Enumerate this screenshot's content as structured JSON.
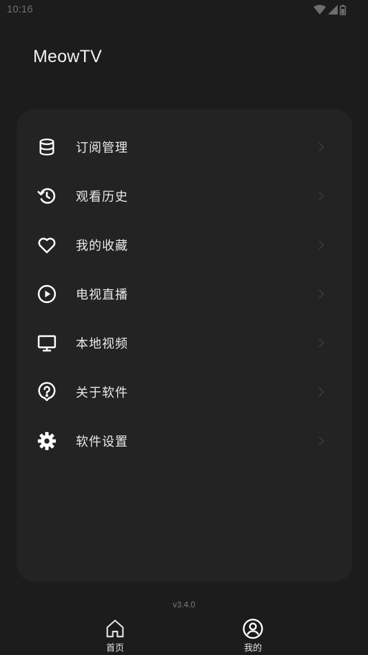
{
  "status_bar": {
    "time": "10:16",
    "icons": [
      "wifi-icon",
      "signal-icon",
      "battery-icon"
    ]
  },
  "app": {
    "title": "MeowTV"
  },
  "menu": {
    "items": [
      {
        "label": "订阅管理",
        "icon": "database-icon"
      },
      {
        "label": "观看历史",
        "icon": "history-icon"
      },
      {
        "label": "我的收藏",
        "icon": "heart-icon"
      },
      {
        "label": "电视直播",
        "icon": "play-circle-icon"
      },
      {
        "label": "本地视频",
        "icon": "monitor-icon"
      },
      {
        "label": "关于软件",
        "icon": "help-icon"
      },
      {
        "label": "软件设置",
        "icon": "gear-icon"
      }
    ]
  },
  "footer": {
    "version": "v3.4.0"
  },
  "bottom_nav": {
    "items": [
      {
        "label": "首页",
        "icon": "home-icon"
      },
      {
        "label": "我的",
        "icon": "user-circle-icon"
      }
    ]
  },
  "colors": {
    "background": "#1c1c1c",
    "card": "#232323",
    "text": "#eaeaea",
    "muted": "#7a7a7a"
  }
}
